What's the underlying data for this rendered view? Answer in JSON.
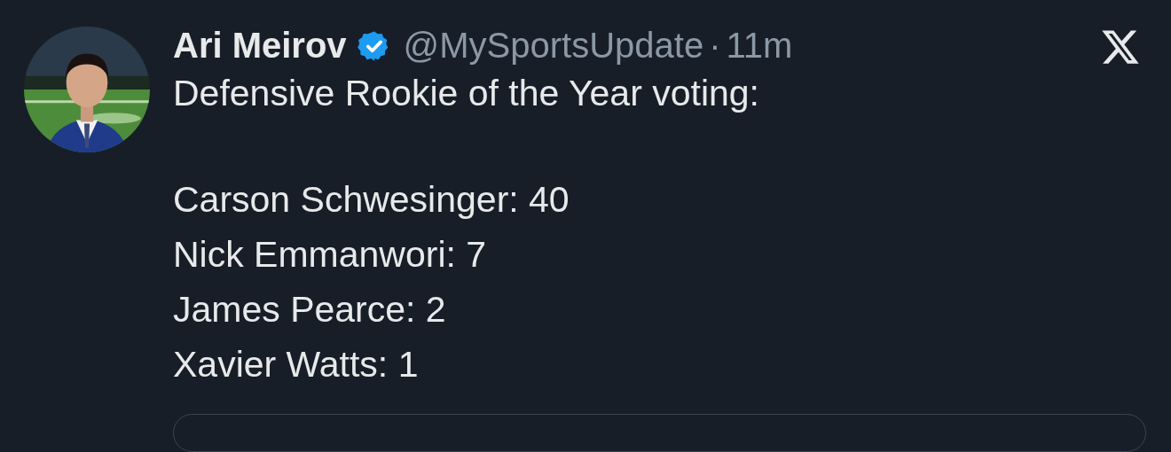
{
  "author": {
    "name": "Ari Meirov",
    "verified": true,
    "handle": "@MySportsUpdate",
    "separator": "·",
    "time": "11m"
  },
  "tweet": {
    "heading": "Defensive Rookie of the Year voting:",
    "lines": [
      "Carson Schwesinger: 40",
      "Nick Emmanwori: 7",
      "James Pearce: 2",
      "Xavier Watts: 1"
    ]
  }
}
